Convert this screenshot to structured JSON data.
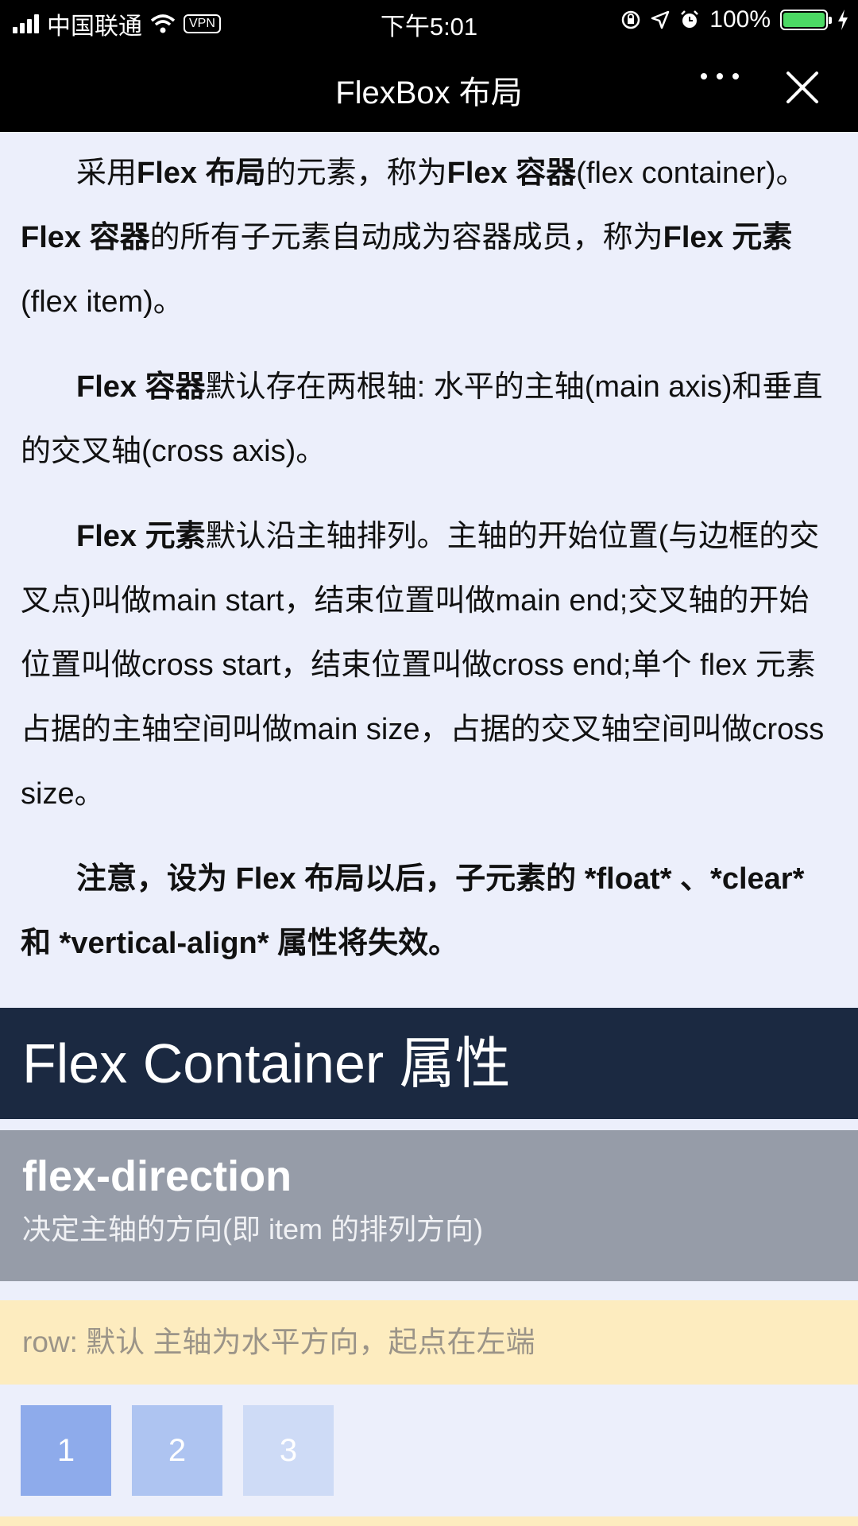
{
  "status_bar": {
    "carrier": "中国联通",
    "vpn": "VPN",
    "time": "下午5:01",
    "battery": "100%",
    "battery_color": "#4cd964"
  },
  "nav": {
    "title": "FlexBox 布局",
    "more_icon": "more-dots-icon",
    "close_icon": "close-icon"
  },
  "article": {
    "p1": [
      {
        "t": "采用",
        "b": false
      },
      {
        "t": "Flex 布局",
        "b": true
      },
      {
        "t": "的元素，称为",
        "b": false
      },
      {
        "t": "Flex 容器",
        "b": true
      },
      {
        "t": "(flex container)。",
        "b": false
      },
      {
        "t": "Flex 容器",
        "b": true
      },
      {
        "t": "的所有子元素自动成为容器成员，称为",
        "b": false
      },
      {
        "t": "Flex 元素",
        "b": true
      },
      {
        "t": "(flex item)。",
        "b": false
      }
    ],
    "p2": [
      {
        "t": "Flex 容器",
        "b": true
      },
      {
        "t": "默认存在两根轴: 水平的主轴(main axis)和垂直的交叉轴(cross axis)。",
        "b": false
      }
    ],
    "p3": [
      {
        "t": "Flex 元素",
        "b": true
      },
      {
        "t": "默认沿主轴排列。主轴的开始位置(与边框的交叉点)叫做main start，结束位置叫做main end;交叉轴的开始位置叫做cross start，结束位置叫做cross end;单个 flex 元素占据的主轴空间叫做main size，占据的交叉轴空间叫做cross size。",
        "b": false
      }
    ],
    "p4": [
      {
        "t": "注意，设为 Flex 布局以后，子元素的 *float* 、*clear* 和 *vertical-align* 属性将失效。",
        "b": true
      }
    ]
  },
  "section": {
    "title": "Flex Container 属性"
  },
  "property": {
    "name": "flex-direction",
    "description": "决定主轴的方向(即 item 的排列方向)"
  },
  "example": {
    "label": "row: 默认 主轴为水平方向，起点在左端",
    "items": [
      {
        "label": "1",
        "color": "#8eabeb"
      },
      {
        "label": "2",
        "color": "#aec4f1"
      },
      {
        "label": "3",
        "color": "#cedbf6"
      }
    ]
  },
  "colors": {
    "page_bg": "#eceffb",
    "header_bg": "#1b2941",
    "property_bg": "#969ca8",
    "example_bg": "#fdecbf"
  }
}
